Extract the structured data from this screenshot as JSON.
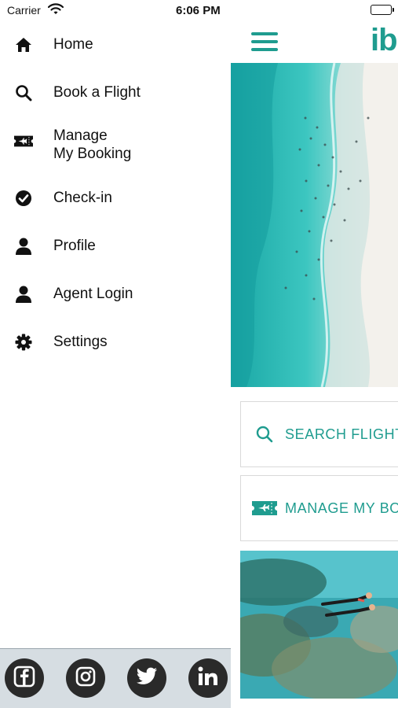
{
  "status_bar": {
    "carrier": "Carrier",
    "time": "6:06 PM"
  },
  "drawer": {
    "menu": [
      {
        "label": "Home",
        "icon": "home-icon"
      },
      {
        "label": "Book a Flight",
        "icon": "search-icon"
      },
      {
        "label": "Manage\nMy Booking",
        "icon": "ticket-icon"
      },
      {
        "label": "Check-in",
        "icon": "check-circle-icon"
      },
      {
        "label": "Profile",
        "icon": "user-icon"
      },
      {
        "label": "Agent Login",
        "icon": "user-icon"
      },
      {
        "label": "Settings",
        "icon": "gear-icon"
      }
    ],
    "social": [
      {
        "name": "facebook",
        "icon": "facebook-icon"
      },
      {
        "name": "instagram",
        "icon": "instagram-icon"
      },
      {
        "name": "twitter",
        "icon": "twitter-icon"
      },
      {
        "name": "linkedin",
        "icon": "linkedin-icon"
      }
    ]
  },
  "app": {
    "brand_text": "ib",
    "search_card_label": "SEARCH FLIGHT",
    "manage_card_label": "MANAGE MY BO",
    "accent_color": "#1f9c8f"
  }
}
